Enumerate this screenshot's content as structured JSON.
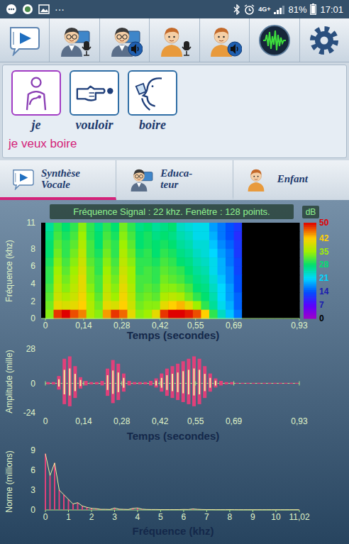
{
  "status_bar": {
    "dots": "···",
    "network": "4G+",
    "signal_level": 0.75,
    "battery": "81%",
    "battery_level": 0.81,
    "time": "17:01"
  },
  "sentence": {
    "pictograms": [
      {
        "label": "je",
        "selected": true
      },
      {
        "label": "vouloir",
        "selected": false
      },
      {
        "label": "boire",
        "selected": false
      }
    ],
    "text": "je veux boire"
  },
  "tabs": [
    {
      "label_lines": [
        "Synthèse",
        "Vocale"
      ],
      "selected": true
    },
    {
      "label_lines": [
        "Educa-",
        "teur"
      ],
      "selected": false
    },
    {
      "label_lines": [
        "Enfant"
      ],
      "selected": false
    }
  ],
  "spectrogram": {
    "title": "Fréquence Signal : 22 khz. Fenêtre : 128 points.",
    "y_label": "Fréquence (khz)",
    "y_ticks": [
      "11",
      "8",
      "6",
      "4",
      "2",
      "0"
    ],
    "x_label": "Temps (secondes)",
    "x_ticks": [
      "0",
      "0,14",
      "0,28",
      "0,42",
      "0,55",
      "0,69",
      "0,93"
    ],
    "colorbar": {
      "label": "dB",
      "ticks": [
        "50",
        "42",
        "35",
        "28",
        "21",
        "14",
        "7",
        "0"
      ]
    },
    "db_by_band_top_to_bottom": [
      [
        26,
        30,
        28,
        30,
        34,
        30,
        27,
        30,
        28,
        33,
        30,
        27,
        28,
        26,
        27,
        28,
        24,
        23,
        22,
        22,
        18,
        16,
        14,
        12,
        0,
        0,
        0,
        0,
        0,
        0,
        0
      ],
      [
        27,
        31,
        29,
        31,
        35,
        30,
        28,
        31,
        29,
        34,
        31,
        28,
        29,
        27,
        28,
        27,
        25,
        24,
        22,
        22,
        19,
        16,
        14,
        11,
        0,
        0,
        0,
        0,
        0,
        0,
        0
      ],
      [
        28,
        32,
        30,
        32,
        36,
        31,
        28,
        32,
        30,
        35,
        32,
        28,
        29,
        28,
        29,
        28,
        26,
        25,
        23,
        23,
        20,
        17,
        15,
        12,
        0,
        0,
        0,
        0,
        0,
        0,
        0
      ],
      [
        28,
        33,
        30,
        33,
        37,
        31,
        29,
        33,
        30,
        36,
        33,
        29,
        30,
        28,
        30,
        29,
        27,
        26,
        24,
        23,
        21,
        18,
        16,
        12,
        0,
        0,
        0,
        0,
        0,
        0,
        0
      ],
      [
        29,
        34,
        31,
        34,
        38,
        32,
        30,
        34,
        31,
        37,
        34,
        30,
        30,
        29,
        31,
        30,
        28,
        27,
        25,
        24,
        22,
        19,
        16,
        13,
        0,
        0,
        0,
        0,
        0,
        0,
        0
      ],
      [
        30,
        35,
        32,
        35,
        39,
        33,
        30,
        35,
        32,
        38,
        35,
        30,
        31,
        30,
        32,
        31,
        30,
        28,
        26,
        25,
        22,
        19,
        17,
        13,
        0,
        0,
        0,
        0,
        0,
        0,
        0
      ],
      [
        30,
        36,
        33,
        36,
        40,
        33,
        31,
        36,
        33,
        39,
        35,
        31,
        31,
        30,
        33,
        32,
        31,
        29,
        27,
        26,
        23,
        20,
        17,
        14,
        0,
        0,
        0,
        0,
        0,
        0,
        0
      ],
      [
        31,
        37,
        34,
        37,
        40,
        34,
        31,
        37,
        34,
        40,
        36,
        31,
        32,
        31,
        34,
        34,
        33,
        31,
        28,
        27,
        24,
        21,
        18,
        14,
        0,
        0,
        0,
        0,
        0,
        0,
        0
      ],
      [
        32,
        38,
        36,
        38,
        41,
        35,
        32,
        38,
        35,
        41,
        37,
        32,
        33,
        32,
        36,
        37,
        36,
        33,
        30,
        28,
        25,
        21,
        18,
        15,
        0,
        0,
        0,
        0,
        0,
        0,
        0
      ],
      [
        33,
        40,
        39,
        40,
        42,
        36,
        33,
        40,
        39,
        42,
        38,
        33,
        34,
        34,
        40,
        42,
        43,
        40,
        35,
        30,
        26,
        22,
        19,
        15,
        0,
        0,
        0,
        0,
        0,
        0,
        0
      ],
      [
        34,
        48,
        50,
        47,
        45,
        36,
        34,
        44,
        48,
        46,
        40,
        34,
        35,
        40,
        48,
        50,
        50,
        49,
        47,
        42,
        30,
        24,
        20,
        16,
        0,
        0,
        0,
        0,
        0,
        0,
        0
      ]
    ]
  },
  "waveform": {
    "y_label": "Amplitude (mille)",
    "y_ticks": [
      "28",
      "0",
      "-24"
    ],
    "x_label": "Temps (secondes)",
    "x_ticks": [
      "0",
      "0,14",
      "0,28",
      "0,42",
      "0,55",
      "0,69",
      "0,93"
    ],
    "amplitude": [
      1,
      1,
      6,
      20,
      22,
      14,
      5,
      2,
      1,
      1,
      2,
      12,
      19,
      16,
      8,
      2,
      1,
      1,
      1,
      2,
      4,
      8,
      12,
      14,
      16,
      18,
      20,
      22,
      20,
      14,
      8,
      4,
      2,
      1,
      1,
      0,
      0,
      0,
      0,
      0,
      0,
      0,
      0,
      0,
      0,
      0,
      0
    ]
  },
  "spectrum": {
    "y_label": "Norme (millions)",
    "y_ticks": [
      "9",
      "6",
      "3",
      "0"
    ],
    "x_label": "Fréquence (khz)",
    "x_ticks": [
      "0",
      "1",
      "2",
      "3",
      "4",
      "5",
      "6",
      "7",
      "8",
      "9",
      "10",
      "11,02"
    ],
    "norm": [
      8.5,
      5.2,
      7.1,
      3.0,
      2.3,
      1.6,
      0.9,
      1.1,
      0.6,
      0.4,
      0.25,
      0.2,
      0.1,
      0.1,
      0.08,
      0.3,
      0.12,
      0.1,
      0.08,
      0.25,
      0.3,
      0.12,
      0.08,
      0.06,
      0.06,
      0.05,
      0.05,
      0.05,
      0.05,
      0.05,
      0.08,
      0.06,
      0.15,
      0.1,
      0.06,
      0.05,
      0.05,
      0.04,
      0.04,
      0.04,
      0.05,
      0.04,
      0.03,
      0.03,
      0.03,
      0.03,
      0.03,
      0.03,
      0.03,
      0.03,
      0.03,
      0.03,
      0.03,
      0.03,
      0.03,
      0.03
    ]
  }
}
